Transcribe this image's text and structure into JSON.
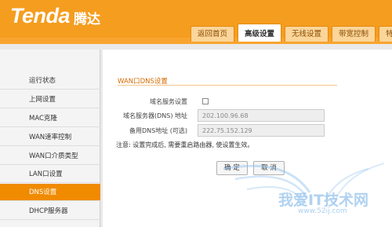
{
  "header": {
    "logo_en": "Tenda",
    "logo_cn": "腾达",
    "tabs": [
      {
        "label": "返回首页"
      },
      {
        "label": "高级设置"
      },
      {
        "label": "无线设置"
      },
      {
        "label": "带宽控制"
      },
      {
        "label": "特殊"
      }
    ]
  },
  "sidebar": {
    "items": [
      {
        "label": "运行状态"
      },
      {
        "label": "上网设置"
      },
      {
        "label": "MAC克隆"
      },
      {
        "label": "WAN速率控制"
      },
      {
        "label": "WAN口介质类型"
      },
      {
        "label": "LAN口设置"
      },
      {
        "label": "DNS设置"
      },
      {
        "label": "DHCP服务器"
      }
    ],
    "active_label": "DNS设置"
  },
  "main": {
    "section_title": "WAN口DNS设置",
    "dns_enable_label": "域名服务设置",
    "primary_dns_label": "域名服务器(DNS) 地址",
    "primary_dns_value": "202.100.96.68",
    "secondary_dns_label": "备用DNS地址 (可选)",
    "secondary_dns_value": "222.75.152.129",
    "note": "注意: 设置完成后, 需要重启路由器, 使设置生效。",
    "ok_label": "确 定",
    "cancel_label": "取 消"
  },
  "watermark": {
    "text": "我爱IT技术网",
    "url": "www.52ij.com"
  },
  "colors": {
    "brand_orange": "#f59d1f",
    "active_item": "#f08b00",
    "section_title": "#d46a00"
  }
}
